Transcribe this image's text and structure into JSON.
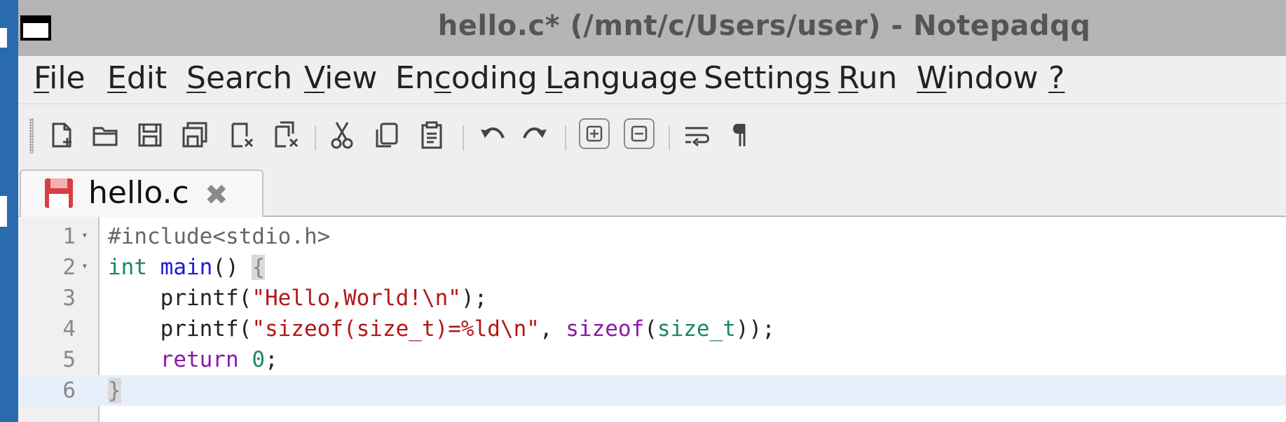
{
  "window": {
    "title": "hello.c* (/mnt/c/Users/user) - Notepadqq"
  },
  "menu": [
    {
      "u": "F",
      "rest": "ile"
    },
    {
      "u": "E",
      "rest": "dit"
    },
    {
      "u": "S",
      "rest": "earch"
    },
    {
      "u": "V",
      "rest": "iew"
    },
    {
      "pre": "En",
      "u": "c",
      "rest": "oding"
    },
    {
      "u": "L",
      "rest": "anguage"
    },
    {
      "pre": "Setting",
      "u": "s",
      "rest": ""
    },
    {
      "u": "R",
      "rest": "un"
    },
    {
      "u": "W",
      "rest": "indow"
    },
    {
      "u": "?",
      "rest": ""
    }
  ],
  "toolbar": {
    "icons": [
      "new-file-icon",
      "open-file-icon",
      "save-icon",
      "save-all-icon",
      "close-icon",
      "close-all-icon",
      "cut-icon",
      "copy-icon",
      "paste-icon",
      "undo-icon",
      "redo-icon",
      "zoom-in-icon",
      "zoom-out-icon",
      "word-wrap-icon",
      "show-all-chars-icon"
    ]
  },
  "tab": {
    "label": "hello.c",
    "close_glyph": "✖",
    "status_icon": "save-red-icon"
  },
  "editor": {
    "current_line": 6,
    "lines": [
      {
        "num": "1",
        "fold": "▾"
      },
      {
        "num": "2",
        "fold": "▾"
      },
      {
        "num": "3",
        "fold": ""
      },
      {
        "num": "4",
        "fold": ""
      },
      {
        "num": "5",
        "fold": ""
      },
      {
        "num": "6",
        "fold": ""
      }
    ],
    "tokens": {
      "l1": "#include<stdio.h>",
      "l2_kw": "int",
      "l2_fn": "main",
      "l2_paren": "()",
      "l2_brace": "{",
      "l3_indent": "    ",
      "l3_call": "printf(",
      "l3_str": "\"Hello,World!\\n\"",
      "l3_end": ");",
      "l4_indent": "    ",
      "l4_call": "printf(",
      "l4_str": "\"sizeof(size_t)=%ld\\n\"",
      "l4_comma": ", ",
      "l4_sizeof": "sizeof",
      "l4_open": "(",
      "l4_type": "size_t",
      "l4_end": "));",
      "l5_indent": "    ",
      "l5_kw": "return",
      "l5_sp": " ",
      "l5_num": "0",
      "l5_end": ";",
      "l6_brace": "}"
    }
  },
  "colors": {
    "title_bar": "#b5b5b5",
    "keyword_type": "#1a8a5c",
    "function": "#1b1bd4",
    "string": "#b21818",
    "keyword_flow": "#8a1aa8",
    "current_line": "#e7f0fa"
  }
}
